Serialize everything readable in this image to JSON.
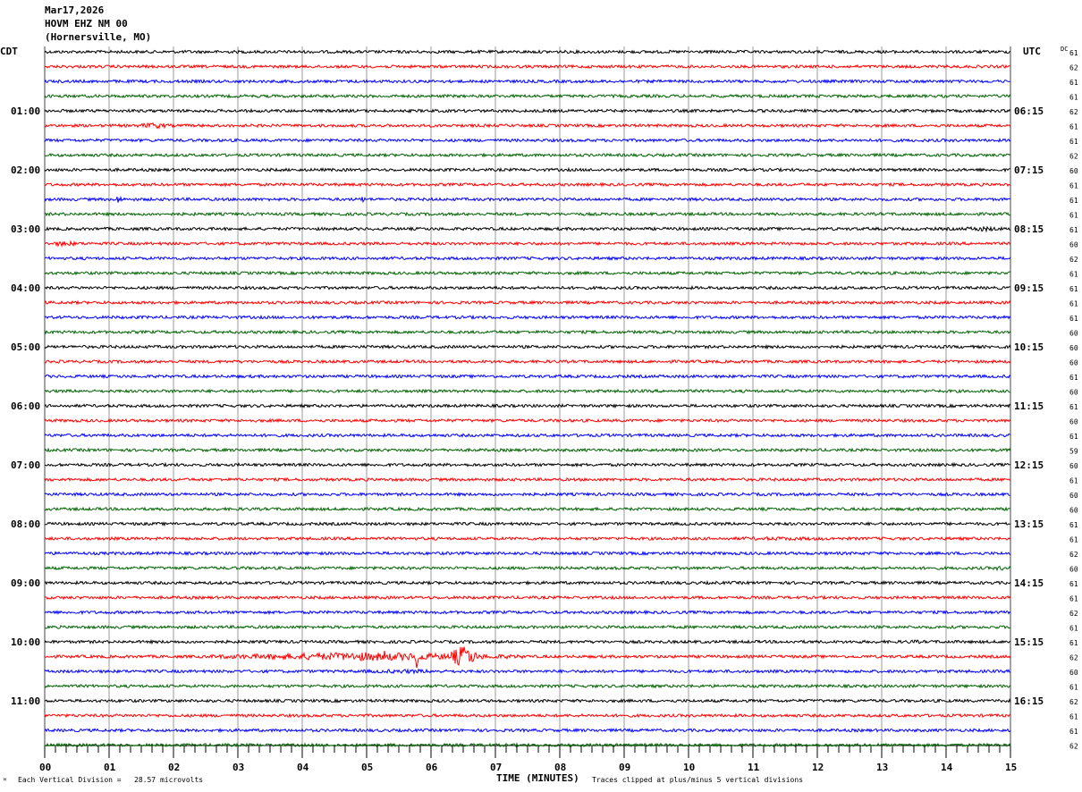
{
  "header": {
    "date": "Mar17,2026",
    "station": "HOVM EHZ NM 00",
    "location": "(Hornersville, MO)"
  },
  "chart_data": {
    "type": "line",
    "title": "HOVM EHZ NM 00 helicorder Mar17,2026",
    "xlabel": "TIME (MINUTES)",
    "left_axis_title": "CDT",
    "right_axis_title": "UTC",
    "dc_title": "DC",
    "xlim": [
      0,
      15
    ],
    "x_ticks": [
      "00",
      "01",
      "02",
      "03",
      "04",
      "05",
      "06",
      "07",
      "08",
      "09",
      "10",
      "11",
      "12",
      "13",
      "14",
      "15"
    ],
    "rows": 48,
    "row_minutes": 15,
    "trace_colors": [
      "#000000",
      "#ff0000",
      "#0000ff",
      "#006400"
    ],
    "left_hour_labels": [
      "01:00",
      "02:00",
      "03:00",
      "04:00",
      "05:00",
      "06:00",
      "07:00",
      "08:00",
      "09:00",
      "10:00",
      "11:00"
    ],
    "right_hour_labels": [
      "06:15",
      "07:15",
      "08:15",
      "09:15",
      "10:15",
      "11:15",
      "12:15",
      "13:15",
      "14:15",
      "15:15",
      "16:15"
    ],
    "dc_values": [
      61,
      62,
      61,
      61,
      62,
      61,
      61,
      62,
      60,
      61,
      61,
      61,
      61,
      60,
      62,
      61,
      61,
      61,
      61,
      60,
      60,
      60,
      61,
      60,
      61,
      60,
      61,
      59,
      60,
      61,
      60,
      60,
      61,
      61,
      62,
      60,
      61,
      61,
      62,
      61,
      61,
      62,
      60,
      61,
      62,
      61,
      61,
      62
    ],
    "events": [
      {
        "row": 5,
        "start_min": 1.4,
        "end_min": 2.0,
        "amp": 2.2
      },
      {
        "row": 10,
        "start_min": 1.1,
        "end_min": 1.2,
        "amp": 3.5
      },
      {
        "row": 10,
        "start_min": 4.9,
        "end_min": 4.98,
        "amp": 2.5
      },
      {
        "row": 12,
        "start_min": 14.1,
        "end_min": 15.0,
        "amp": 1.8
      },
      {
        "row": 13,
        "start_min": 0.0,
        "end_min": 0.6,
        "amp": 2.0
      },
      {
        "row": 33,
        "start_min": 9.0,
        "end_min": 13.8,
        "amp": 1.3
      },
      {
        "row": 35,
        "start_min": 14.7,
        "end_min": 15.0,
        "amp": 1.8
      },
      {
        "row": 40,
        "start_min": 13.2,
        "end_min": 13.8,
        "amp": 1.4
      },
      {
        "row": 41,
        "start_min": 2.5,
        "end_min": 7.5,
        "amp": 3.0
      },
      {
        "row": 41,
        "start_min": 5.75,
        "end_min": 5.85,
        "amp": 11
      },
      {
        "row": 41,
        "start_min": 6.3,
        "end_min": 6.7,
        "amp": 8
      },
      {
        "row": 42,
        "start_min": 4.2,
        "end_min": 7.0,
        "amp": 1.5
      },
      {
        "row": 41,
        "start_min": 5.22,
        "end_min": 5.3,
        "amp": 6
      }
    ],
    "footer_left": "Each Vertical Division =   28.57 microvolts",
    "footer_right": "Traces clipped at plus/minus 5 vertical divisions"
  }
}
